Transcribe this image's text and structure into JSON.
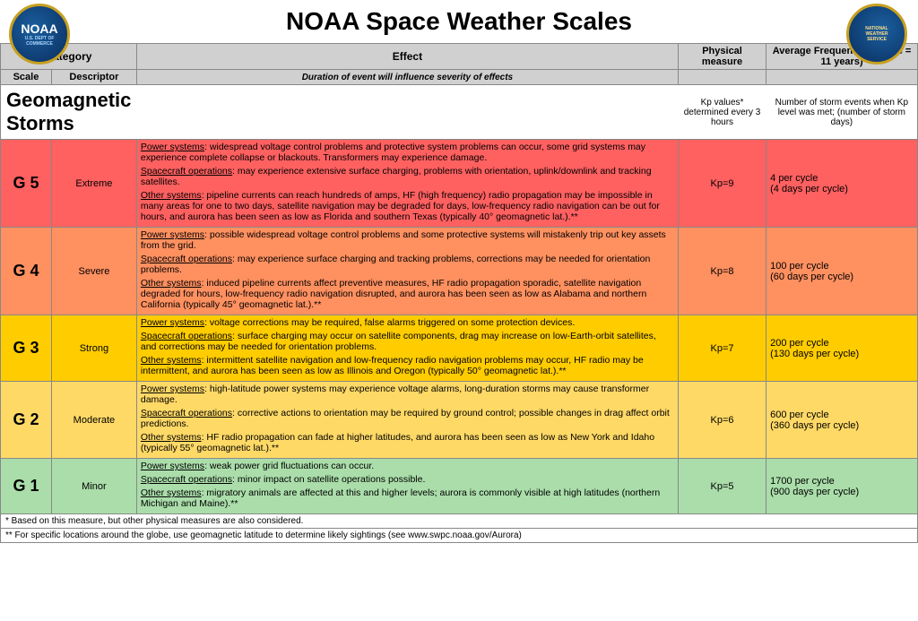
{
  "header": {
    "title": "NOAA Space Weather Scales",
    "noaa_label": "NOAA",
    "nws_label": "NATIONAL WEATHER SERVICE"
  },
  "table": {
    "col_headers": {
      "category": "Category",
      "effect": "Effect",
      "physical_measure": "Physical measure",
      "avg_frequency": "Average Frequency (1 cycle = 11 years)"
    },
    "sub_headers": {
      "scale": "Scale",
      "descriptor": "Descriptor",
      "duration_note": "Duration of event will influence severity of effects"
    },
    "section_title": "Geomagnetic Storms",
    "kp_note": "Kp values* determined every 3 hours",
    "freq_note": "Number of storm events when Kp level was met; (number of storm days)",
    "rows": [
      {
        "scale": "G 5",
        "descriptor": "Extreme",
        "bg_class": "row-g5",
        "effect": "Power systems: widespread voltage control problems and protective system problems can occur, some grid systems may experience complete collapse or blackouts. Transformers may experience damage.\nSpacecraft operations: may experience extensive surface charging, problems with orientation, uplink/downlink and tracking satellites.\nOther systems: pipeline currents can reach hundreds of amps, HF (high frequency) radio propagation may be impossible in many areas for one to two days, satellite navigation may be degraded for days, low-frequency radio navigation can be out for hours, and aurora has been seen as low as Florida and southern Texas (typically 40° geomagnetic lat.).**",
        "physical": "Kp=9",
        "frequency": "4 per cycle\n(4 days per cycle)"
      },
      {
        "scale": "G 4",
        "descriptor": "Severe",
        "bg_class": "row-g4",
        "effect": "Power systems: possible widespread voltage control problems and some protective systems will mistakenly trip out key assets from the grid.\nSpacecraft operations: may experience surface charging and tracking problems, corrections may be needed for orientation problems.\nOther systems: induced pipeline currents affect preventive measures, HF radio propagation sporadic, satellite navigation degraded for hours, low-frequency radio navigation disrupted, and aurora has been seen as low as Alabama and northern California (typically 45° geomagnetic lat.).**",
        "physical": "Kp=8",
        "frequency": "100 per cycle\n(60 days per cycle)"
      },
      {
        "scale": "G 3",
        "descriptor": "Strong",
        "bg_class": "row-g3",
        "effect": "Power systems: voltage corrections may be required, false alarms triggered on some protection devices.\nSpacecraft operations: surface charging may occur on satellite components, drag may increase on low-Earth-orbit satellites, and corrections may be needed for orientation problems.\nOther systems: intermittent satellite navigation and low-frequency radio navigation problems may occur, HF radio may be intermittent, and aurora has been seen as low as Illinois and Oregon  (typically 50° geomagnetic lat.).**",
        "physical": "Kp=7",
        "frequency": "200 per cycle\n(130 days per cycle)"
      },
      {
        "scale": "G 2",
        "descriptor": "Moderate",
        "bg_class": "row-g2",
        "effect": "Power systems: high-latitude power systems may experience voltage alarms, long-duration storms may cause transformer damage.\nSpacecraft operations: corrective actions to orientation may be required by ground control; possible changes in drag affect orbit predictions.\nOther systems: HF radio propagation can fade at higher latitudes, and aurora has been seen as low as New York and Idaho (typically 55° geomagnetic lat.).**",
        "physical": "Kp=6",
        "frequency": "600 per cycle\n(360 days per cycle)"
      },
      {
        "scale": "G 1",
        "descriptor": "Minor",
        "bg_class": "row-g1",
        "effect": "Power systems: weak power grid fluctuations can occur.\nSpacecraft operations: minor impact on satellite operations possible.\nOther systems: migratory animals are affected at this and higher levels; aurora is commonly visible at high latitudes (northern Michigan and Maine).**",
        "physical": "Kp=5",
        "frequency": "1700 per cycle\n(900 days per cycle)"
      }
    ],
    "footnotes": [
      "*   Based on this measure, but other physical measures are also considered.",
      "**  For specific locations around the globe, use geomagnetic latitude to determine likely sightings (see www.swpc.noaa.gov/Aurora)"
    ]
  }
}
